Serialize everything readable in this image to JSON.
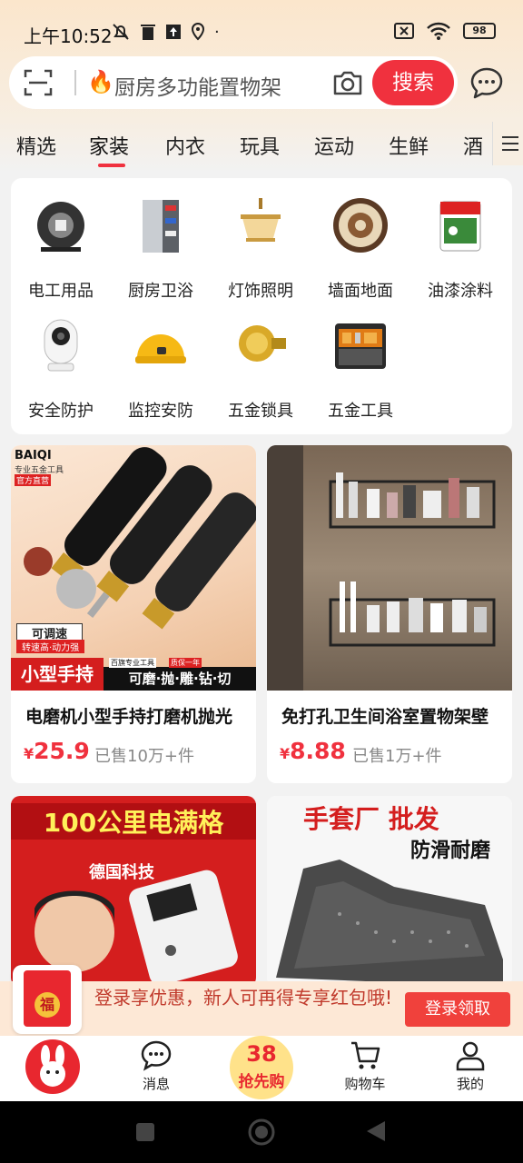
{
  "status_bar": {
    "time": "上午10:52",
    "battery": "98"
  },
  "search": {
    "placeholder": "厨房多功能置物架",
    "button": "搜索"
  },
  "tabs": [
    "精选",
    "家装",
    "内衣",
    "玩具",
    "运动",
    "生鲜",
    "酒"
  ],
  "categories": [
    {
      "label": "电工用品",
      "icon": "cable-reel-icon"
    },
    {
      "label": "厨房卫浴",
      "icon": "cabinet-icon"
    },
    {
      "label": "灯饰照明",
      "icon": "chandelier-icon"
    },
    {
      "label": "墙面地面",
      "icon": "carpet-icon"
    },
    {
      "label": "油漆涂料",
      "icon": "paint-bucket-icon"
    },
    {
      "label": "安全防护",
      "icon": "camera-icon"
    },
    {
      "label": "监控安防",
      "icon": "helmet-icon"
    },
    {
      "label": "五金锁具",
      "icon": "door-knob-icon"
    },
    {
      "label": "五金工具",
      "icon": "toolbox-icon"
    }
  ],
  "products": [
    {
      "title": "电磨机小型手持打磨机抛光",
      "currency": "¥",
      "price": "25.9",
      "sold": "已售10万+件",
      "image_text": {
        "brand": "BAIQI",
        "brand_sub": "专业五金工具",
        "badge": "官方直营",
        "tag1": "可调速",
        "tag2": "转速高·动力强",
        "big": "小型手持",
        "bottom": "可磨·抛·雕·钻·切",
        "bottom_tag1": "百旗专业工具",
        "bottom_tag2": "质保一年"
      }
    },
    {
      "title": "免打孔卫生间浴室置物架壁",
      "currency": "¥",
      "price": "8.88",
      "sold": "已售1万+件"
    },
    {
      "title": "",
      "image_text": {
        "headline": "100公里电满格",
        "sub": "德国科技"
      }
    },
    {
      "title": "",
      "image_text": {
        "headline": "手套厂 批发",
        "sub": "防滑耐磨"
      }
    }
  ],
  "promo": {
    "text": "登录享优惠，新人可再得专享红包哦!",
    "button": "登录领取",
    "badge": "福"
  },
  "bottom_nav": [
    {
      "label": "",
      "icon": "rabbit-logo-icon"
    },
    {
      "label": "消息",
      "icon": "chat-icon"
    },
    {
      "label": "38\n抢先购",
      "top": "38",
      "bottom": "抢先购",
      "icon": "sale-badge-icon"
    },
    {
      "label": "购物车",
      "icon": "cart-icon"
    },
    {
      "label": "我的",
      "icon": "user-icon"
    }
  ],
  "colors": {
    "accent": "#f0313e",
    "background": "#f2f2f2",
    "top_gradient": "#fbe6cc"
  }
}
